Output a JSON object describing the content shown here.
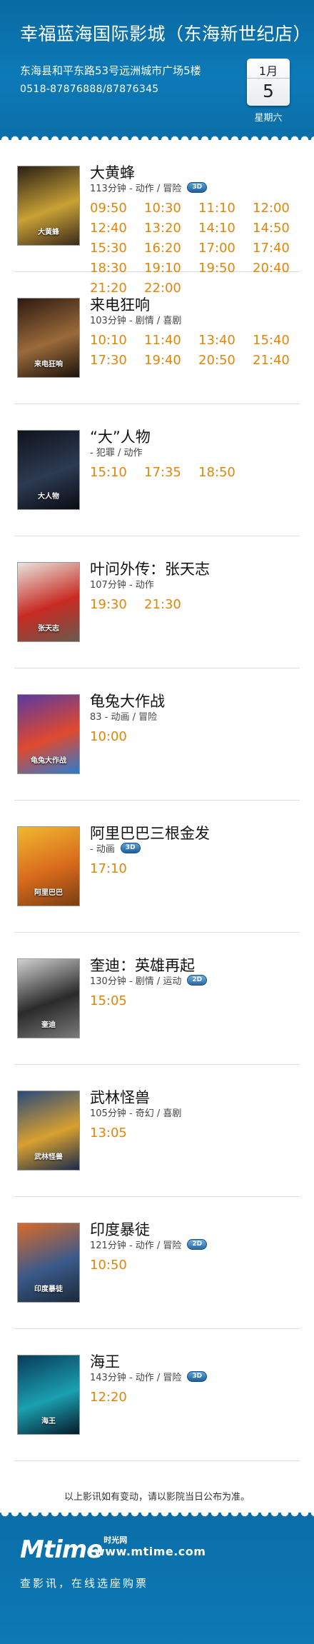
{
  "header": {
    "cinema_name": "幸福蓝海国际影城（东海新世纪店）",
    "address": "东海县和平东路53号远洲城市广场5楼",
    "phone": "0518-87876888/87876345",
    "calendar": {
      "month": "1月",
      "day": "5",
      "weekday": "星期六"
    }
  },
  "movies": [
    {
      "title": "大黄蜂",
      "meta": "113分钟 - 动作 / 冒险",
      "badge": "3D",
      "poster_text": "大黄蜂",
      "poster_colors": [
        "#2a2016",
        "#c9a135",
        "#3b2a1a"
      ],
      "times": [
        "09:50",
        "10:30",
        "11:10",
        "12:00",
        "12:40",
        "13:20",
        "14:10",
        "14:50",
        "15:30",
        "16:20",
        "17:00",
        "17:40",
        "18:30",
        "19:10",
        "19:50",
        "20:40",
        "21:20",
        "22:00"
      ]
    },
    {
      "title": "来电狂响",
      "meta": "103分钟 - 剧情 / 喜剧",
      "badge": "",
      "poster_text": "来电狂响",
      "poster_colors": [
        "#2e1a12",
        "#9a6a3a",
        "#1c120c"
      ],
      "times": [
        "10:10",
        "11:40",
        "13:40",
        "15:40",
        "17:30",
        "19:40",
        "20:50",
        "21:40"
      ]
    },
    {
      "title": "“大”人物",
      "meta": "- 犯罪 / 动作",
      "badge": "",
      "poster_text": "大人物",
      "poster_colors": [
        "#10141c",
        "#2c3a52",
        "#0a0c12"
      ],
      "times": [
        "15:10",
        "17:35",
        "18:50"
      ]
    },
    {
      "title": "叶问外传：张天志",
      "meta": "107分钟 - 动作",
      "badge": "",
      "poster_text": "张天志",
      "poster_colors": [
        "#e8e4de",
        "#c72a22",
        "#6a5a4e"
      ],
      "times": [
        "19:30",
        "21:30"
      ]
    },
    {
      "title": "龟兔大作战",
      "meta": "83 - 动画 / 冒险",
      "badge": "",
      "poster_text": "龟兔大作战",
      "poster_colors": [
        "#5a3aa0",
        "#e0492e",
        "#2b7bd0"
      ],
      "times": [
        "10:00"
      ]
    },
    {
      "title": "阿里巴巴三根金发",
      "meta": "- 动画",
      "badge": "3D",
      "poster_text": "阿里巴巴",
      "poster_colors": [
        "#f0b830",
        "#d86a1c",
        "#7a3e12"
      ],
      "times": [
        "17:10"
      ]
    },
    {
      "title": "奎迪：英雄再起",
      "meta": "130分钟 - 剧情 / 运动",
      "badge": "2D",
      "poster_text": "奎迪",
      "poster_colors": [
        "#d0d0d0",
        "#2a2a2a",
        "#7a7a7a"
      ],
      "times": [
        "15:05"
      ]
    },
    {
      "title": "武林怪兽",
      "meta": "105分钟 - 奇幻 / 喜剧",
      "badge": "",
      "poster_text": "武林怪兽",
      "poster_colors": [
        "#2a4a7a",
        "#d8a030",
        "#1a2a4a"
      ],
      "times": [
        "13:05"
      ]
    },
    {
      "title": "印度暴徒",
      "meta": "121分钟 - 动作 / 冒险",
      "badge": "2D",
      "poster_text": "印度暴徒",
      "poster_colors": [
        "#d86a2a",
        "#3a5a8a",
        "#1a2a3a"
      ],
      "times": [
        "10:50"
      ]
    },
    {
      "title": "海王",
      "meta": "143分钟 - 动作 / 冒险",
      "badge": "3D",
      "poster_text": "海王",
      "poster_colors": [
        "#0a3a5a",
        "#1aa0b0",
        "#061a2a"
      ],
      "times": [
        "12:20"
      ]
    }
  ],
  "notice": "以上影讯如有变动，请以影院当日公布为准。",
  "footer": {
    "logo_mark": "Mtime",
    "logo_cn": "时光网",
    "site_url": "www.mtime.com",
    "slogan": "查影讯，在线选座购票"
  },
  "icons": {
    "calendar": "calendar-icon",
    "format_badge": "format-badge-icon"
  }
}
